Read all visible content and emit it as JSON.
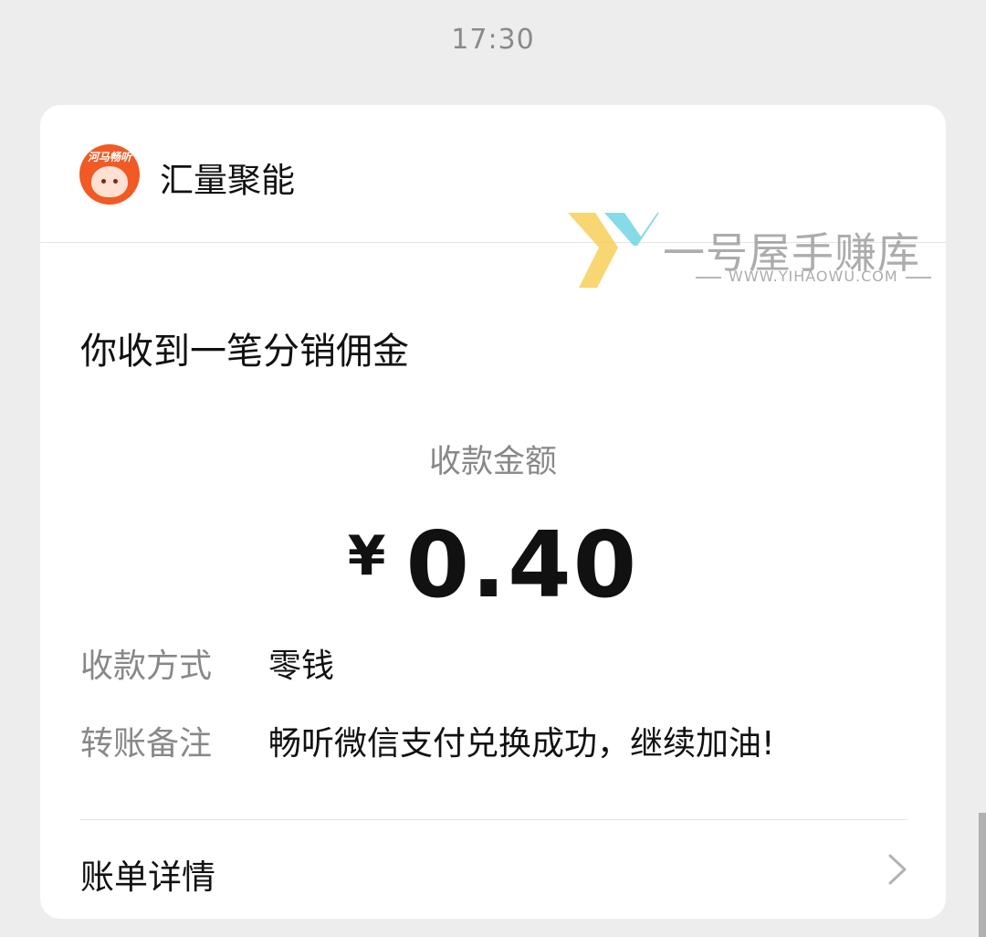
{
  "time": "17:30",
  "card": {
    "sender_name": "汇量聚能",
    "avatar_logo_text": "河马畅听",
    "message_title": "你收到一笔分销佣金",
    "amount_label": "收款金额",
    "currency": "¥",
    "amount": "0.40",
    "method_label": "收款方式",
    "method_value": "零钱",
    "note_label": "转账备注",
    "note_value": "畅听微信支付兑换成功，继续加油!",
    "detail_label": "账单详情"
  },
  "watermark": {
    "title": "一号屋手赚库",
    "subtitle": "WWW.YIHAOWU.COM"
  },
  "colors": {
    "background": "#ededed",
    "card": "#ffffff",
    "avatar": "#f15a24",
    "watermark_yellow": "#f5c842",
    "watermark_teal": "#5ecfe0"
  },
  "icons": {
    "avatar": "hippo-logo-icon",
    "detail": "chevron-right-icon",
    "watermark": "y-logo-icon"
  }
}
